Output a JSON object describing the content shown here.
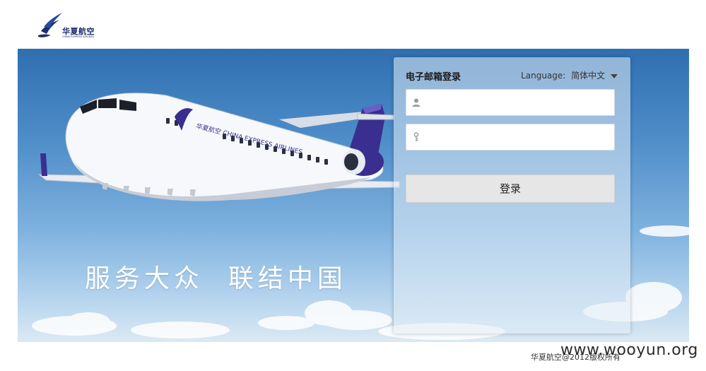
{
  "header": {
    "logo_text": "华夏航空",
    "logo_subtext": "CHINA EXPRESS AIRLINES"
  },
  "hero": {
    "slogan": "服务大众  联结中国",
    "aircraft_livery": "华夏航空 CHINA EXPRESS AIRLINES"
  },
  "login": {
    "title": "电子邮箱登录",
    "language_label": "Language:",
    "language_value": "简体中文",
    "username_placeholder": "",
    "password_placeholder": "",
    "username_icon": "user-icon",
    "password_icon": "key-icon",
    "submit_label": "登录"
  },
  "footer": {
    "copyright": "华夏航空@2012版权所有",
    "watermark": "www.wooyun.org"
  },
  "colors": {
    "brand": "#1b2f6b",
    "sky_top": "#2f6fb0",
    "tail": "#3a2f8f"
  }
}
